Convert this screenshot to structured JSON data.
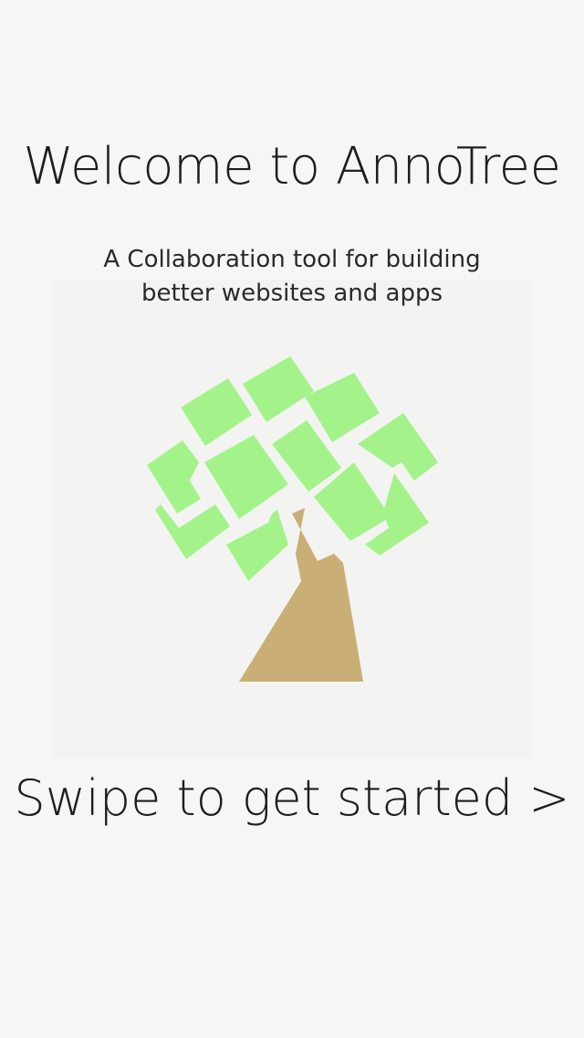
{
  "welcome": {
    "title": "Welcome to AnnoTree",
    "subtitle_line1": "A Collaboration tool for building",
    "subtitle_line2": "better websites and apps",
    "cta": "Swipe to get started >"
  },
  "logo": {
    "icon": "annotree-logo-icon",
    "leaf_color": "#a3f38a",
    "trunk_color": "#c9ae75"
  },
  "colors": {
    "background": "#f6f6f4",
    "logo_panel": "#f3f3f1",
    "text": "#1e1e1e"
  }
}
